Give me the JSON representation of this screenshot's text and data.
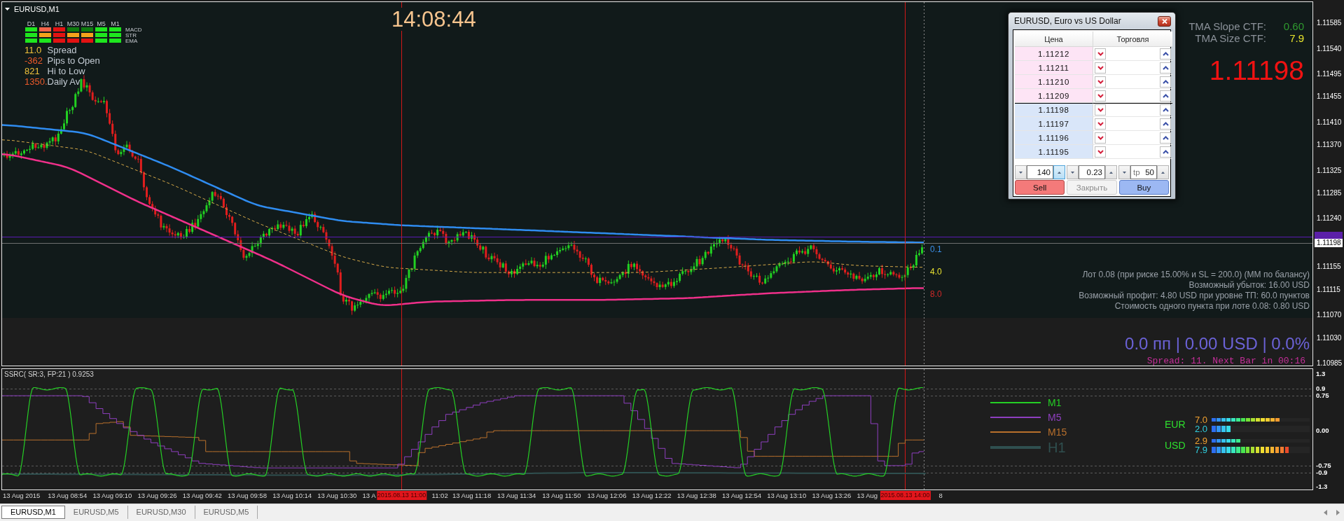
{
  "chart": {
    "title": "EURUSD,M1",
    "clock": "14:08:44",
    "signal_matrix": {
      "columns": [
        "D1",
        "H4",
        "H1",
        "M30",
        "M15",
        "M5",
        "M1"
      ],
      "rows": [
        {
          "label": "MACD",
          "cells": [
            {
              "color": "#1ee61e"
            },
            {
              "color": "#f2644a"
            },
            {
              "color": "#e31212"
            },
            {
              "color": "#0f7a0f"
            },
            {
              "color": "#0f7a0f"
            },
            {
              "color": "#1ee61e"
            },
            {
              "color": "#1ee61e"
            }
          ]
        },
        {
          "label": "STR",
          "cells": [
            {
              "color": "#1ee61e"
            },
            {
              "color": "#f5a21b"
            },
            {
              "color": "#e31212"
            },
            {
              "color": "#f5a21b"
            },
            {
              "color": "#f5a21b"
            },
            {
              "color": "#1ee61e"
            },
            {
              "color": "#1ee61e"
            }
          ]
        },
        {
          "label": "EMA",
          "cells": [
            {
              "color": "#1ee61e"
            },
            {
              "color": "#1ee61e"
            },
            {
              "color": "#e31212"
            },
            {
              "color": "#e31212"
            },
            {
              "color": "#e31212"
            },
            {
              "color": "#1ee61e"
            },
            {
              "color": "#1ee61e"
            }
          ]
        }
      ]
    },
    "stats": [
      {
        "figure": "11.0",
        "text": "Spread",
        "color": "#f0c23a"
      },
      {
        "figure": "-362",
        "text": "Pips to Open",
        "color": "#ec5a2a"
      },
      {
        "figure": "821",
        "text": "Hi to Low",
        "color": "#f0c23a"
      },
      {
        "figure": "1350.",
        "text": "Daily Av",
        "color": "#ec5a2a"
      }
    ],
    "tma": [
      {
        "label": "TMA Slope CTF:",
        "value": "0.60",
        "color": "#2f9a2f"
      },
      {
        "label": "TMA Size CTF:",
        "value": "7.9",
        "color": "#e8e42c"
      }
    ],
    "current_price": "1.11198",
    "band_labels": [
      {
        "text": "0.1",
        "color": "#3a8ee6"
      },
      {
        "text": "4.0",
        "color": "#e8e030"
      },
      {
        "text": "8.0",
        "color": "#d02828"
      }
    ],
    "risk_info": [
      "Лот 0.08 (при риске 15.00% и SL = 200.0) (ММ по балансу)",
      "Возможный убыток: 16.00 USD",
      "Возможный профит: 4.80 USD при уровне ТП: 60.0 пунктов",
      "Стоимость одного пункта при лоте 0.08: 0.80 USD"
    ],
    "pnl": "0.0 пп | 0.00 USD | 0.0%",
    "bar_info": "Spread: 11. Next Bar in 00:16"
  },
  "trade_panel": {
    "title": "EURUSD, Euro vs US Dollar",
    "columns": [
      "Цена",
      "Торговля"
    ],
    "rows": [
      {
        "price": "1.11212",
        "kind": "ask"
      },
      {
        "price": "1.11211",
        "kind": "ask"
      },
      {
        "price": "1.11210",
        "kind": "ask"
      },
      {
        "price": "1.11209",
        "kind": "ask"
      },
      {
        "price": "1.11198",
        "kind": "bid"
      },
      {
        "price": "1.11197",
        "kind": "bid"
      },
      {
        "price": "1.11196",
        "kind": "bid"
      },
      {
        "price": "1.11195",
        "kind": "bid"
      }
    ],
    "spinners": [
      {
        "value": "140",
        "highlighted": true
      },
      {
        "value": "0.23",
        "highlighted": false
      },
      {
        "prefix": "tp",
        "value": "50",
        "highlighted": false
      }
    ],
    "buttons": [
      {
        "label": "Sell",
        "kind": "sell",
        "disabled": false
      },
      {
        "label": "Закрыть",
        "kind": "close",
        "disabled": true
      },
      {
        "label": "Buy",
        "kind": "buy",
        "disabled": false
      }
    ]
  },
  "price_axis": {
    "ticks": [
      "1.11585",
      "1.11540",
      "1.11495",
      "1.11455",
      "1.11410",
      "1.11370",
      "1.11325",
      "1.11285",
      "1.11240",
      "1.11155",
      "1.11115",
      "1.11070",
      "1.11030",
      "1.10985"
    ],
    "bid_tag": "1.11198"
  },
  "indicator": {
    "title": "SSRC( SR:3, FP:21 ) 0.9253",
    "legend": [
      {
        "label": "M1",
        "color": "#25cf25",
        "kind": "thin"
      },
      {
        "label": "M5",
        "color": "#8e3fbf",
        "kind": "thin"
      },
      {
        "label": "M15",
        "color": "#b8702c",
        "kind": "thin"
      },
      {
        "label": "H1",
        "color": "#2f4f4f",
        "kind": "thick"
      }
    ],
    "strength": [
      {
        "currency": "EUR",
        "meters": [
          {
            "reading": "7.0",
            "level": 0.7,
            "kind": "thin",
            "color": "#f0a030"
          },
          {
            "reading": "2.0",
            "level": 0.2,
            "kind": "thick",
            "color": "#30d0e0"
          }
        ]
      },
      {
        "currency": "USD",
        "meters": [
          {
            "reading": "2.9",
            "level": 0.29,
            "kind": "thin",
            "color": "#f0a030"
          },
          {
            "reading": "7.9",
            "level": 0.79,
            "kind": "thick",
            "color": "#30d0e0"
          }
        ]
      }
    ],
    "axis_ticks": [
      "1.3",
      "0.9",
      "0.75",
      "0.00",
      "-0.75",
      "-0.9",
      "-1.3"
    ]
  },
  "time_axis": {
    "labels": [
      "13 Aug 2015",
      "13 Aug 08:54",
      "13 Aug 09:10",
      "13 Aug 09:26",
      "13 Aug 09:42",
      "13 Aug 09:58",
      "13 Aug 10:14",
      "13 Aug 10:30",
      "13 A",
      "11:02",
      "13 Aug 11:18",
      "13 Aug 11:34",
      "13 Aug 11:50",
      "13 Aug 12:06",
      "13 Aug 12:22",
      "13 Aug 12:38",
      "13 Aug 12:54",
      "13 Aug 13:10",
      "13 Aug 13:26",
      "13 Aug",
      "8"
    ],
    "markers": [
      "2015.08.13 11:00",
      "2015.08.13 14:00"
    ]
  },
  "tabs": [
    {
      "label": "EURUSD,M1",
      "selected": true
    },
    {
      "label": "EURUSD,M5",
      "selected": false
    },
    {
      "label": "EURUSD,M30",
      "selected": false
    },
    {
      "label": "EURUSD,M5",
      "selected": false
    }
  ]
}
